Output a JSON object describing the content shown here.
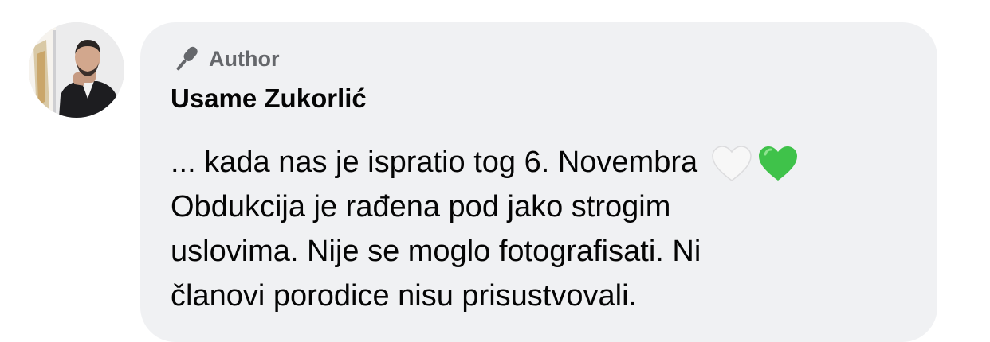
{
  "comment": {
    "badge_label": "Author",
    "author_name": "Usame Zukorlić",
    "lines": [
      "... kada nas je ispratio tog 6. Novembra",
      "Obdukcija je rađena pod jako strogim",
      "uslovima. Nije se moglo fotografisati. Ni",
      "članovi porodice nisu prisustvovali."
    ],
    "emojis": [
      "white-heart-icon",
      "green-heart-icon"
    ]
  },
  "colors": {
    "bubble": "#f0f1f3",
    "badge_text": "#65676b",
    "text": "#050505",
    "green_heart": "#3fc24a",
    "white_heart": "#f4f4f4"
  }
}
